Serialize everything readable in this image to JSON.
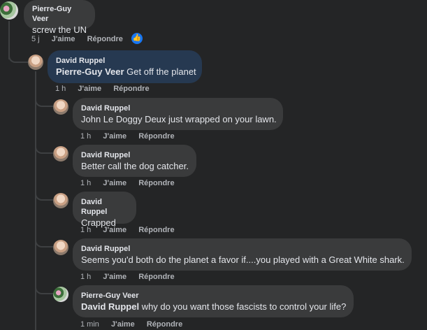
{
  "comments": [
    {
      "author": "Pierre-Guy Veer",
      "text": "screw the UN",
      "time": "5 j",
      "like": "J'aime",
      "reply": "Répondre"
    },
    {
      "author": "David Ruppel",
      "mention": "Pierre-Guy Veer",
      "text": " Get off the planet",
      "time": "1 h",
      "like": "J'aime",
      "reply": "Répondre"
    },
    {
      "author": "David Ruppel",
      "text": "John Le Doggy Deux just wrapped on your lawn.",
      "time": "1 h",
      "like": "J'aime",
      "reply": "Répondre"
    },
    {
      "author": "David Ruppel",
      "text": "Better call the dog catcher.",
      "time": "1 h",
      "like": "J'aime",
      "reply": "Répondre"
    },
    {
      "author": "David Ruppel",
      "text": "Crapped",
      "time": "1 h",
      "like": "J'aime",
      "reply": "Répondre"
    },
    {
      "author": "David Ruppel",
      "text": "Seems you'd both do the planet a favor if....you played with a Great White shark.",
      "time": "1 h",
      "like": "J'aime",
      "reply": "Répondre"
    },
    {
      "author": "Pierre-Guy Veer",
      "mention": "David Ruppel",
      "text": " why do you want those fascists to control your life?",
      "time": "1 min",
      "like": "J'aime",
      "reply": "Répondre"
    }
  ],
  "icons": {
    "like_reaction": "thumbs-up-icon",
    "accent": "#1877f2"
  }
}
